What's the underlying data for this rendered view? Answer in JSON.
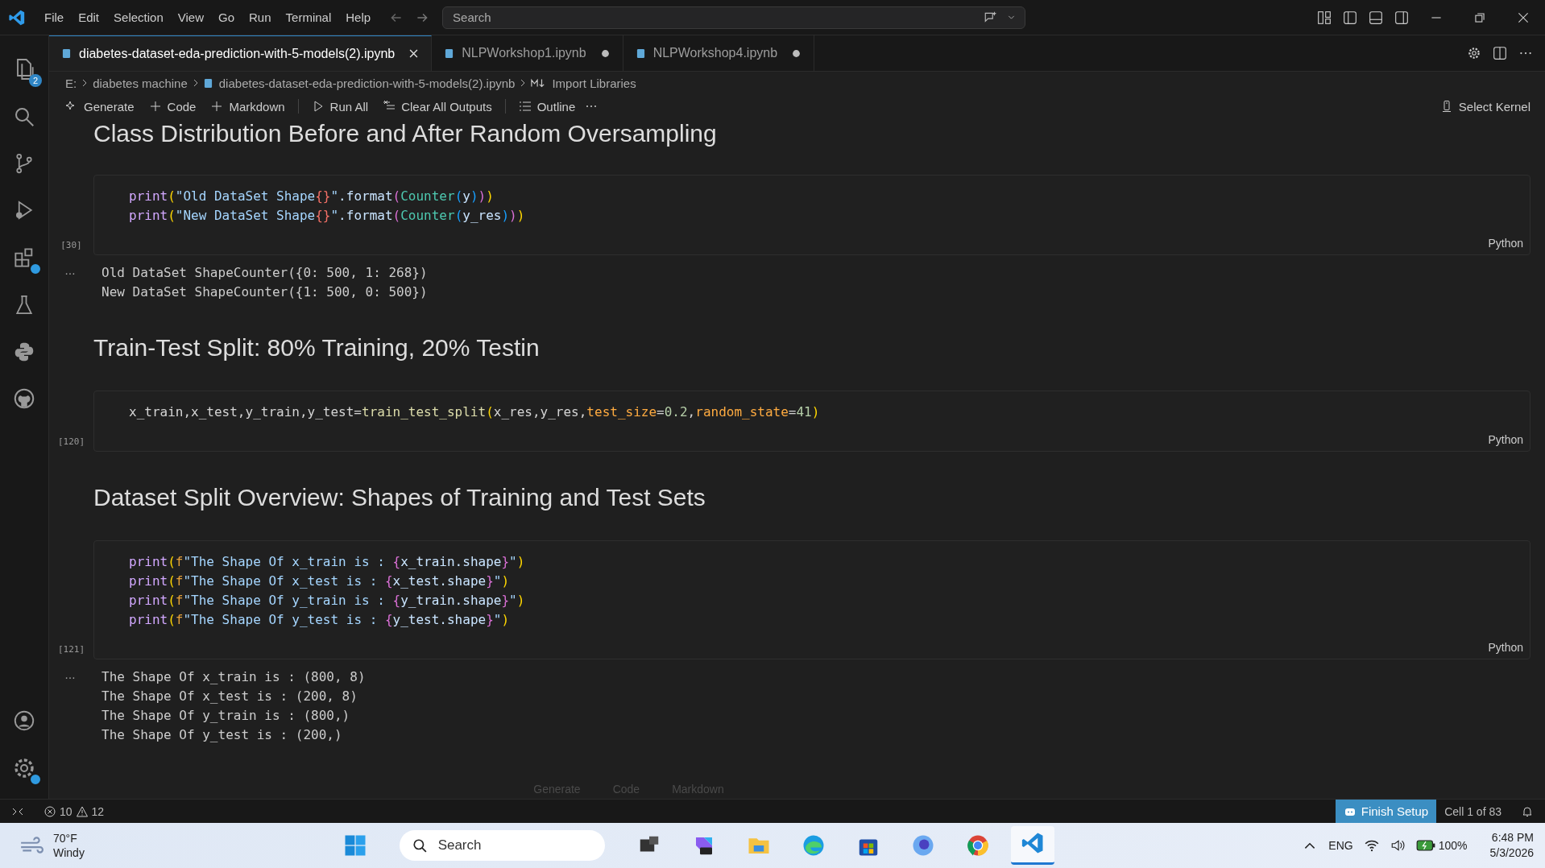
{
  "menu": [
    "File",
    "Edit",
    "Selection",
    "View",
    "Go",
    "Run",
    "Terminal",
    "Help"
  ],
  "search": {
    "placeholder": "Search"
  },
  "activity_badges": {
    "explorer": "2"
  },
  "tabs": [
    {
      "label": "diabetes-dataset-eda-prediction-with-5-models(2).ipynb",
      "selected": true,
      "modified": false
    },
    {
      "label": "NLPWorkshop1.ipynb",
      "selected": false,
      "modified": true
    },
    {
      "label": "NLPWorkshop4.ipynb",
      "selected": false,
      "modified": true
    }
  ],
  "breadcrumb": [
    {
      "label": "E:",
      "kind": "plain"
    },
    {
      "label": "diabetes machine",
      "kind": "plain"
    },
    {
      "label": "diabetes-dataset-eda-prediction-with-5-models(2).ipynb",
      "kind": "notebook"
    },
    {
      "label": "Import Libraries",
      "kind": "markdown"
    }
  ],
  "toolbar": [
    {
      "label": "Generate",
      "kind": "sparkle"
    },
    {
      "label": "Code",
      "kind": "plus"
    },
    {
      "label": "Markdown",
      "kind": "plus"
    },
    {
      "label": "Run All",
      "kind": "run"
    },
    {
      "label": "Clear All Outputs",
      "kind": "clear"
    },
    {
      "label": "Outline",
      "kind": "list"
    }
  ],
  "kernel": "Select Kernel",
  "cells": [
    {
      "kind": "markdown",
      "text": "Class Distribution Before and After Random Oversampling"
    },
    {
      "kind": "code",
      "count": "[30]",
      "language": "Python",
      "lines": [
        [
          {
            "text": "print",
            "kind": "fn"
          },
          {
            "text": "(",
            "kind": "p1"
          },
          {
            "text": "\"Old DataSet Shape",
            "kind": "str"
          },
          {
            "text": "{}",
            "kind": "brace"
          },
          {
            "text": "\"",
            "kind": "str"
          },
          {
            "text": ".format",
            "kind": "var"
          },
          {
            "text": "(",
            "kind": "p2"
          },
          {
            "text": "Counter",
            "kind": "cls"
          },
          {
            "text": "(",
            "kind": "p3"
          },
          {
            "text": "y",
            "kind": "var"
          },
          {
            "text": ")",
            "kind": "p3"
          },
          {
            "text": ")",
            "kind": "p2"
          },
          {
            "text": ")",
            "kind": "p1"
          }
        ],
        [
          {
            "text": "print",
            "kind": "fn"
          },
          {
            "text": "(",
            "kind": "p1"
          },
          {
            "text": "\"New DataSet Shape",
            "kind": "str"
          },
          {
            "text": "{}",
            "kind": "brace"
          },
          {
            "text": "\"",
            "kind": "str"
          },
          {
            "text": ".format",
            "kind": "var"
          },
          {
            "text": "(",
            "kind": "p2"
          },
          {
            "text": "Counter",
            "kind": "cls"
          },
          {
            "text": "(",
            "kind": "p3"
          },
          {
            "text": "y_res",
            "kind": "var"
          },
          {
            "text": ")",
            "kind": "p3"
          },
          {
            "text": ")",
            "kind": "p2"
          },
          {
            "text": ")",
            "kind": "p1"
          }
        ]
      ],
      "output": [
        "Old DataSet ShapeCounter({0: 500, 1: 268})",
        "New DataSet ShapeCounter({1: 500, 0: 500})"
      ]
    },
    {
      "kind": "markdown",
      "text": "Train-Test Split: 80% Training, 20% Testin"
    },
    {
      "kind": "code",
      "count": "[120]",
      "language": "Python",
      "lines": [
        [
          {
            "text": "x_train,x_test,y_train,y_test",
            "kind": "plain"
          },
          {
            "text": "=",
            "kind": "plain"
          },
          {
            "text": "train_test_split",
            "kind": "call"
          },
          {
            "text": "(",
            "kind": "p1"
          },
          {
            "text": "x_res,y_res,",
            "kind": "plain"
          },
          {
            "text": "test_size",
            "kind": "param"
          },
          {
            "text": "=",
            "kind": "plain"
          },
          {
            "text": "0.2",
            "kind": "num"
          },
          {
            "text": ",",
            "kind": "plain"
          },
          {
            "text": "random_state",
            "kind": "param"
          },
          {
            "text": "=",
            "kind": "plain"
          },
          {
            "text": "41",
            "kind": "num"
          },
          {
            "text": ")",
            "kind": "p1"
          }
        ]
      ]
    },
    {
      "kind": "markdown",
      "text": "Dataset Split Overview: Shapes of Training and Test Sets"
    },
    {
      "kind": "code",
      "count": "[121]",
      "language": "Python",
      "lines": [
        [
          {
            "text": "print",
            "kind": "fn"
          },
          {
            "text": "(",
            "kind": "p1"
          },
          {
            "text": "f",
            "kind": "fpre"
          },
          {
            "text": "\"The Shape Of x_train is : ",
            "kind": "str"
          },
          {
            "text": "{",
            "kind": "p2"
          },
          {
            "text": "x_train.shape",
            "kind": "var"
          },
          {
            "text": "}",
            "kind": "p2"
          },
          {
            "text": "\"",
            "kind": "str"
          },
          {
            "text": ")",
            "kind": "p1"
          }
        ],
        [
          {
            "text": "print",
            "kind": "fn"
          },
          {
            "text": "(",
            "kind": "p1"
          },
          {
            "text": "f",
            "kind": "fpre"
          },
          {
            "text": "\"The Shape Of x_test is : ",
            "kind": "str"
          },
          {
            "text": "{",
            "kind": "p2"
          },
          {
            "text": "x_test.shape",
            "kind": "var"
          },
          {
            "text": "}",
            "kind": "p2"
          },
          {
            "text": "\"",
            "kind": "str"
          },
          {
            "text": ")",
            "kind": "p1"
          }
        ],
        [
          {
            "text": "print",
            "kind": "fn"
          },
          {
            "text": "(",
            "kind": "p1"
          },
          {
            "text": "f",
            "kind": "fpre"
          },
          {
            "text": "\"The Shape Of y_train is : ",
            "kind": "str"
          },
          {
            "text": "{",
            "kind": "p2"
          },
          {
            "text": "y_train.shape",
            "kind": "var"
          },
          {
            "text": "}",
            "kind": "p2"
          },
          {
            "text": "\"",
            "kind": "str"
          },
          {
            "text": ")",
            "kind": "p1"
          }
        ],
        [
          {
            "text": "print",
            "kind": "fn"
          },
          {
            "text": "(",
            "kind": "p1"
          },
          {
            "text": "f",
            "kind": "fpre"
          },
          {
            "text": "\"The Shape Of y_test is : ",
            "kind": "str"
          },
          {
            "text": "{",
            "kind": "p2"
          },
          {
            "text": "y_test.shape",
            "kind": "var"
          },
          {
            "text": "}",
            "kind": "p2"
          },
          {
            "text": "\"",
            "kind": "str"
          },
          {
            "text": ")",
            "kind": "p1"
          }
        ]
      ],
      "output": [
        "The Shape Of x_train is : (800, 8)",
        "The Shape Of x_test is : (200, 8)",
        "The Shape Of y_train is : (800,)",
        "The Shape Of y_test is : (200,)"
      ]
    }
  ],
  "hover_toolbar": [
    "Generate",
    "Code",
    "Markdown"
  ],
  "status": {
    "errors": "10",
    "warnings": "12",
    "finish_setup": "Finish Setup",
    "cell_position": "Cell 1 of 83"
  },
  "taskbar": {
    "temperature": "70°F",
    "condition": "Windy",
    "search": "Search",
    "language": "ENG",
    "battery": "100%",
    "time": "6:48 PM",
    "date": "5/3/2026"
  }
}
